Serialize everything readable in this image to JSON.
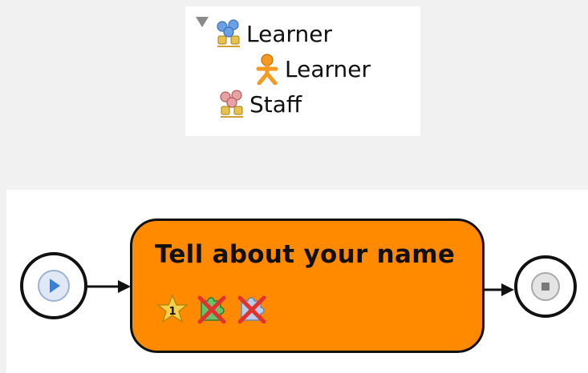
{
  "roles_tree": {
    "groups": [
      {
        "label": "Learner",
        "expanded": true,
        "icon": "learner-group-icon",
        "children": [
          {
            "label": "Learner",
            "icon": "learner-role-icon"
          }
        ]
      },
      {
        "label": "Staff",
        "expanded": false,
        "icon": "staff-group-icon",
        "children": []
      }
    ]
  },
  "flow": {
    "start_icon": "play-icon",
    "end_icon": "stop-icon",
    "activity": {
      "title": "Tell about your name",
      "color": "#ff8a00",
      "icons": [
        "star-one-icon",
        "puzzle-disabled-green-icon",
        "puzzle-disabled-blue-icon"
      ],
      "star_number": "1"
    }
  }
}
